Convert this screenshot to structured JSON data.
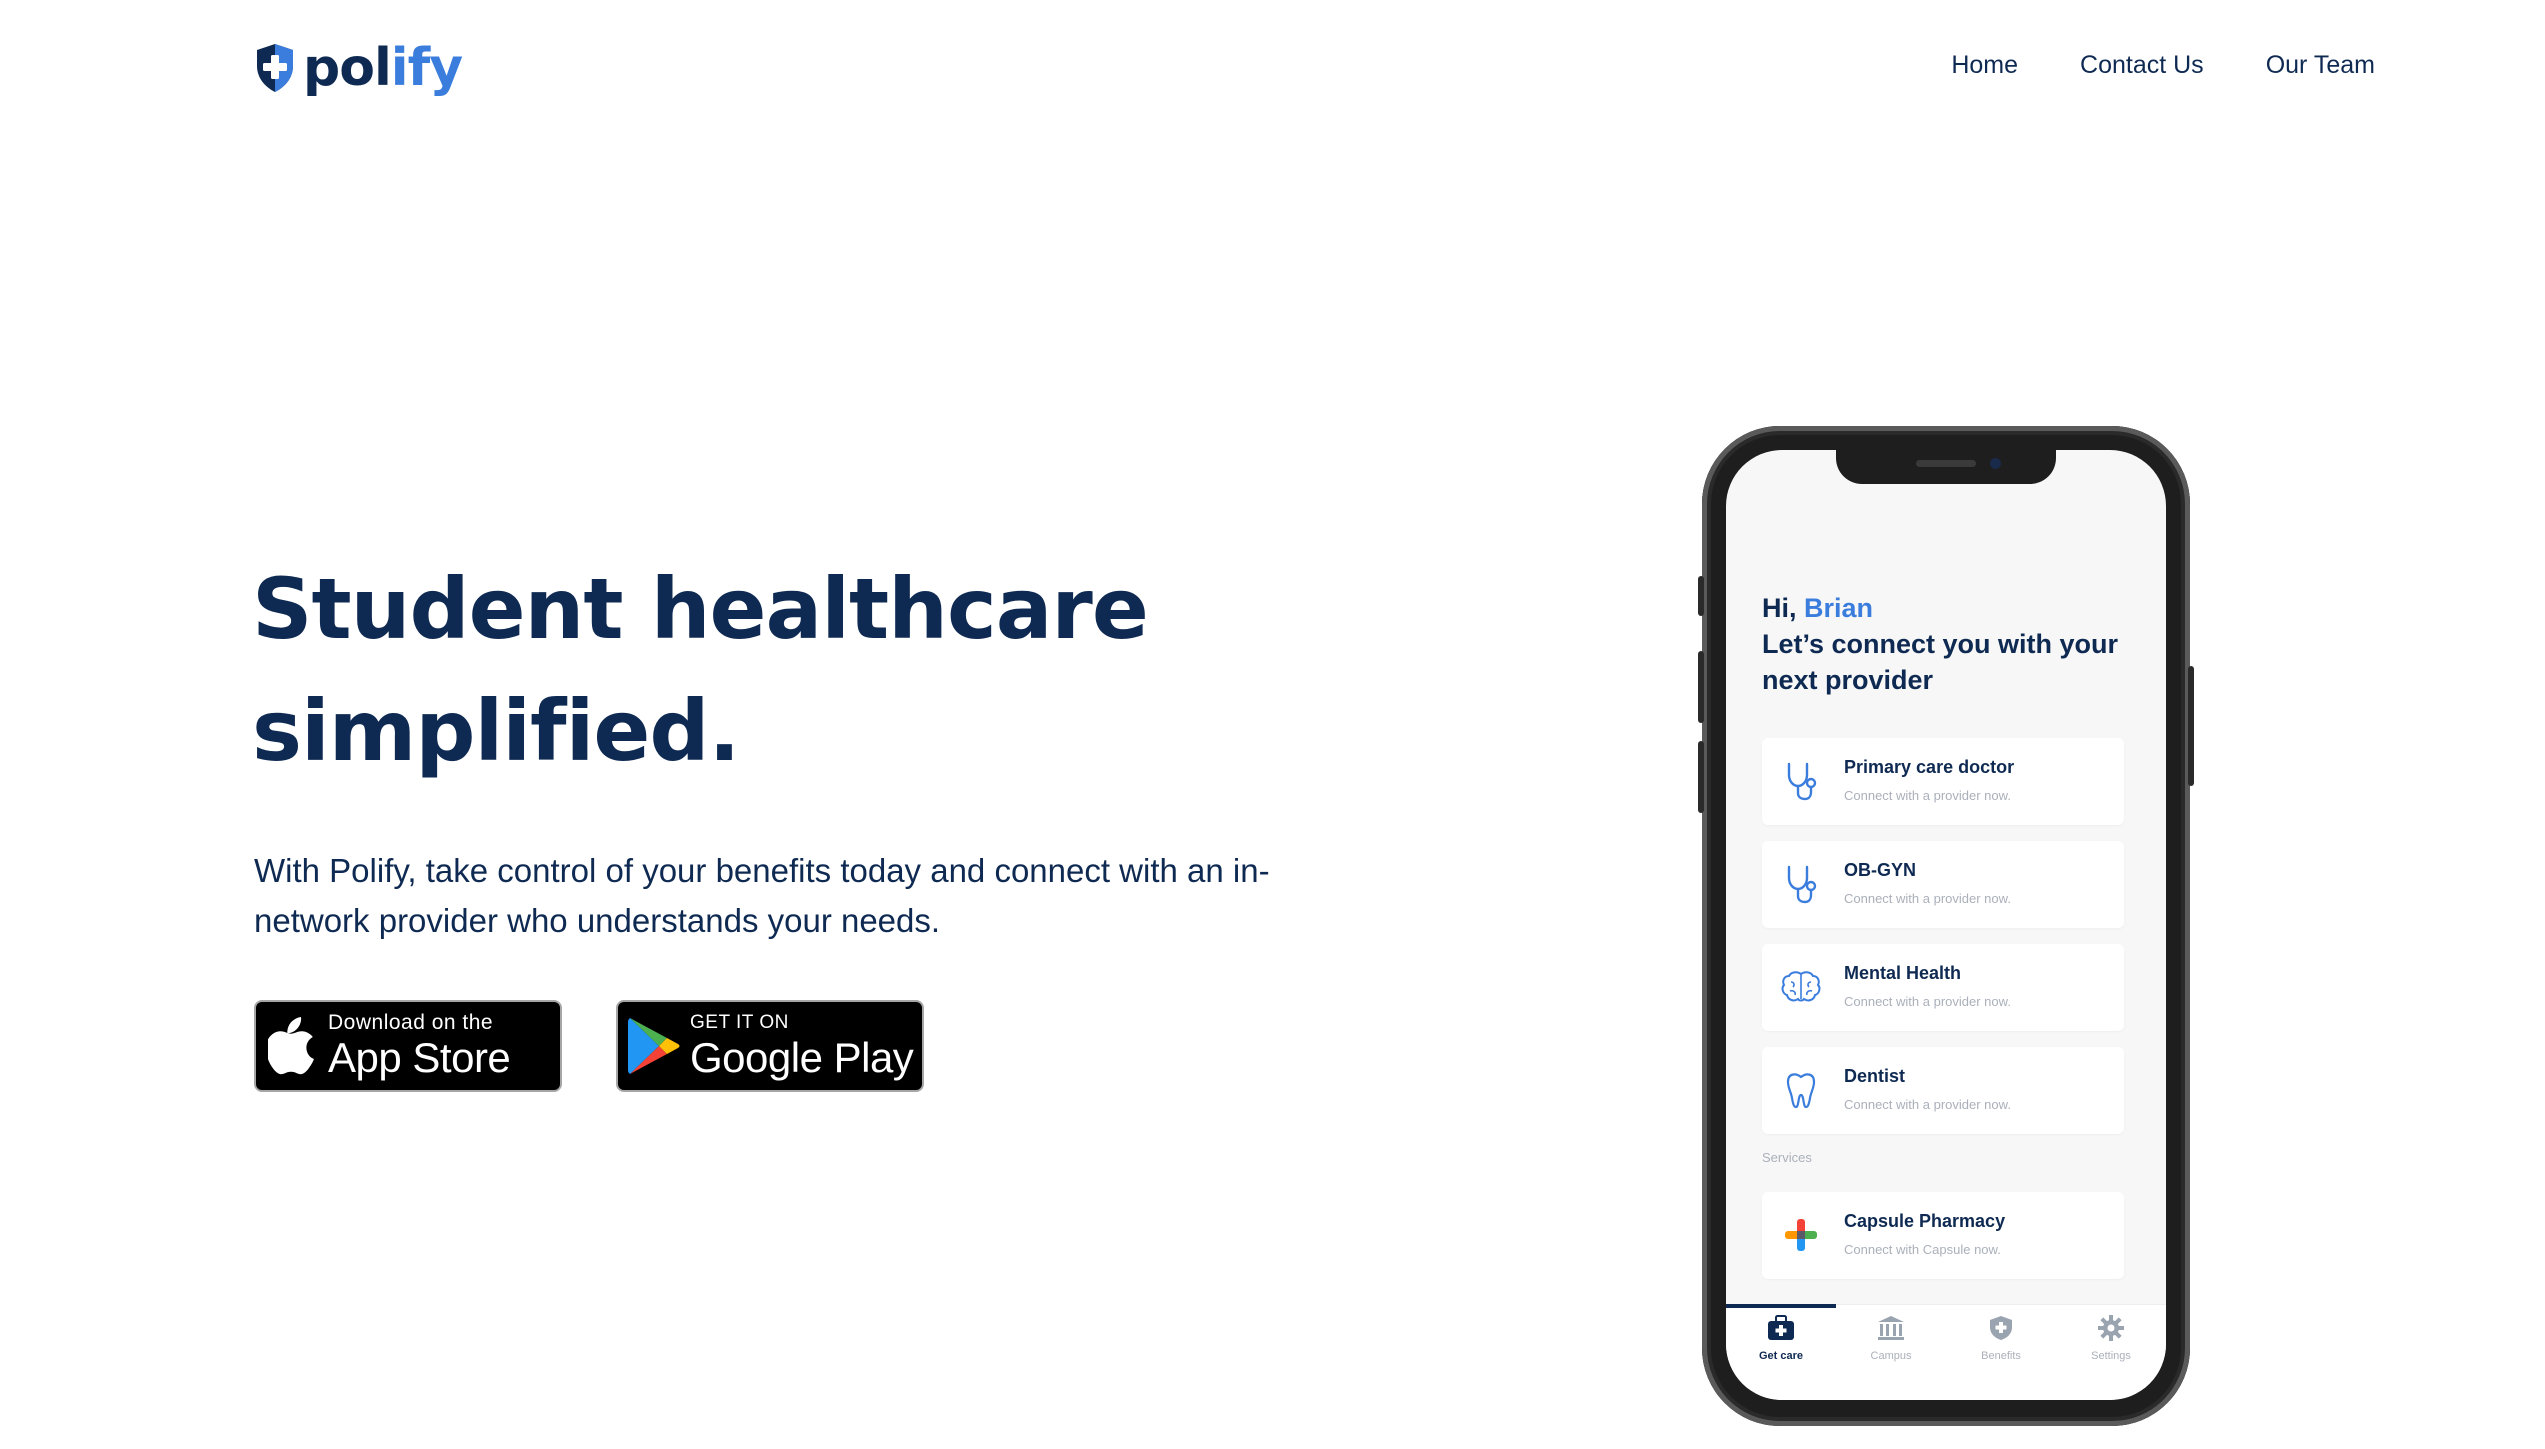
{
  "brand": {
    "name_part1": "pol",
    "name_part2": "ify",
    "primary": "#0f2a52",
    "accent": "#3b7ddd"
  },
  "nav": {
    "items": [
      {
        "label": "Home"
      },
      {
        "label": "Contact Us"
      },
      {
        "label": "Our Team"
      }
    ]
  },
  "hero": {
    "headline_line1": "Student healthcare",
    "headline_line2": "simplified.",
    "subtext": "With Polify, take control of your benefits today and connect with an in-network provider who understands your needs."
  },
  "stores": {
    "app_store": {
      "small": "Download on the",
      "big": "App Store",
      "icon": "apple-icon"
    },
    "google_play": {
      "small": "GET IT ON",
      "big": "Google Play",
      "icon": "google-play-icon"
    }
  },
  "phone": {
    "greeting_prefix": "Hi, ",
    "user_name": "Brian",
    "tagline": "Let’s connect you with your next provider",
    "providers": [
      {
        "title": "Primary care doctor",
        "subtitle": "Connect with a provider now.",
        "icon": "stethoscope-icon"
      },
      {
        "title": "OB-GYN",
        "subtitle": "Connect with a provider now.",
        "icon": "stethoscope-icon"
      },
      {
        "title": "Mental Health",
        "subtitle": "Connect with a provider now.",
        "icon": "brain-icon"
      },
      {
        "title": "Dentist",
        "subtitle": "Connect with a provider now.",
        "icon": "tooth-icon"
      }
    ],
    "services_label": "Services",
    "services": [
      {
        "title": "Capsule Pharmacy",
        "subtitle": "Connect with Capsule now.",
        "icon": "pharmacy-cross-icon"
      }
    ],
    "tabs": [
      {
        "label": "Get care",
        "icon": "medical-kit-icon",
        "active": true
      },
      {
        "label": "Campus",
        "icon": "campus-building-icon",
        "active": false
      },
      {
        "label": "Benefits",
        "icon": "shield-icon",
        "active": false
      },
      {
        "label": "Settings",
        "icon": "gear-icon",
        "active": false
      }
    ]
  }
}
